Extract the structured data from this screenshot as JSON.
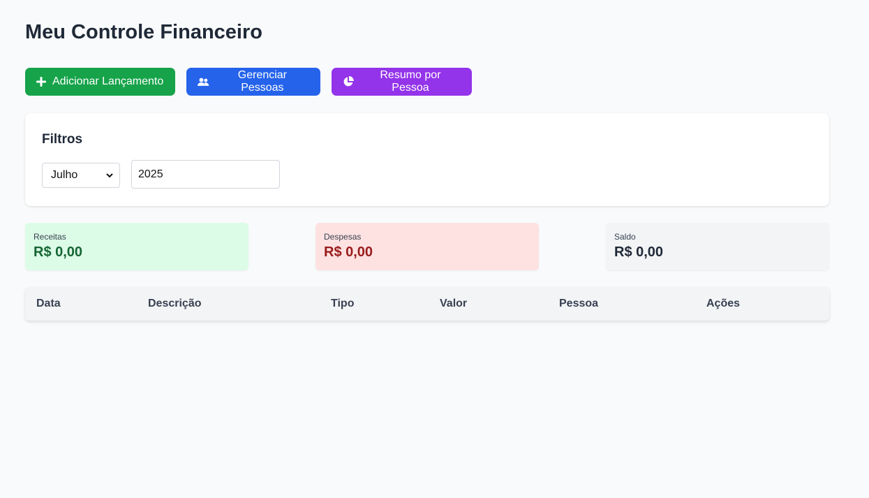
{
  "title": "Meu Controle Financeiro",
  "toolbar": {
    "add_label": "Adicionar Lançamento",
    "people_label": "Gerenciar Pessoas",
    "summary_label": "Resumo por Pessoa"
  },
  "colors": {
    "green": "#16a34a",
    "blue": "#2563eb",
    "purple": "#9333ea"
  },
  "filters": {
    "title": "Filtros",
    "month": "Julho",
    "year": "2025"
  },
  "summary": {
    "income": {
      "label": "Receitas",
      "value": "R$ 0,00"
    },
    "expenses": {
      "label": "Despesas",
      "value": "R$ 0,00"
    },
    "balance": {
      "label": "Saldo",
      "value": "R$ 0,00"
    }
  },
  "table": {
    "columns": [
      "Data",
      "Descrição",
      "Tipo",
      "Valor",
      "Pessoa",
      "Ações"
    ]
  }
}
